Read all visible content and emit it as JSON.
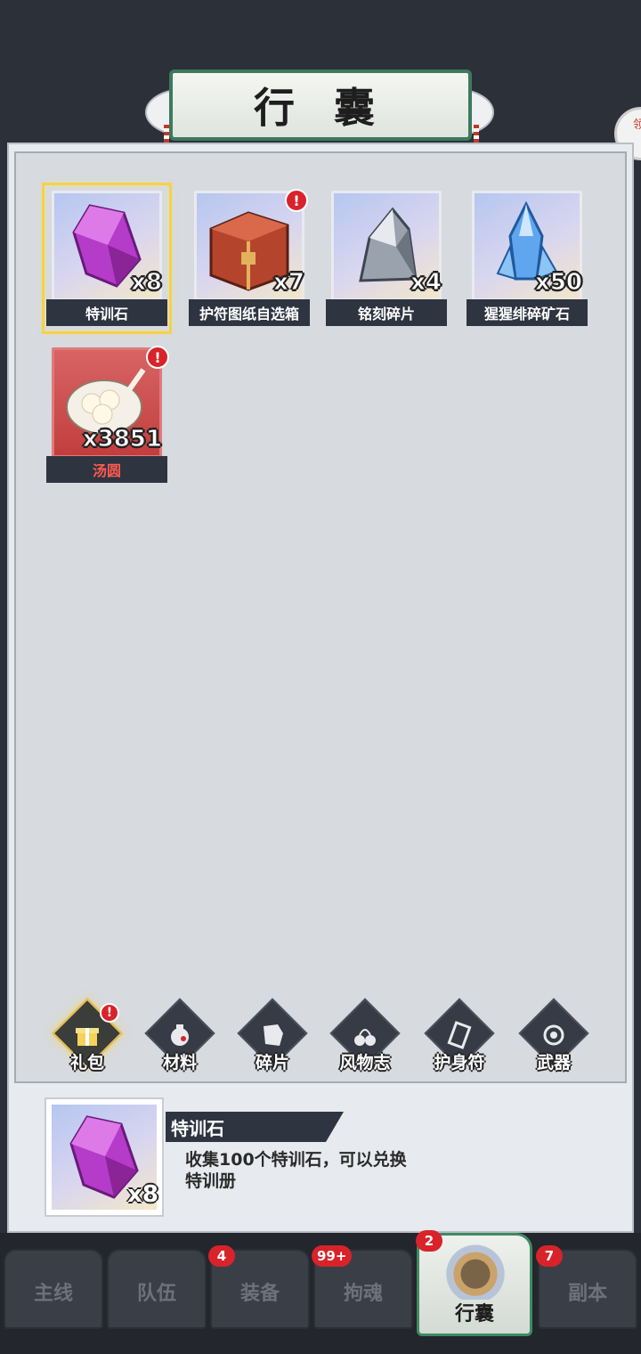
{
  "header": {
    "title": "行 囊"
  },
  "side_token": {
    "text": "领"
  },
  "items": [
    {
      "name": "特训石",
      "count": "x8",
      "selected": true,
      "alert": false,
      "icon": "purple-crystal-icon"
    },
    {
      "name": "护符图纸自选箱",
      "count": "x7",
      "selected": false,
      "alert": true,
      "icon": "treasure-chest-icon"
    },
    {
      "name": "铭刻碎片",
      "count": "x4",
      "selected": false,
      "alert": false,
      "icon": "stone-shard-icon"
    },
    {
      "name": "猩猩绯碎矿石",
      "count": "x50",
      "selected": false,
      "alert": false,
      "icon": "blue-crystal-icon"
    },
    {
      "name": "汤圆",
      "count": "x3851",
      "selected": false,
      "alert": true,
      "icon": "tangyuan-bowl-icon"
    }
  ],
  "alert_mark": "!",
  "categories": [
    {
      "label": "礼包",
      "icon": "gift-icon",
      "active": true,
      "alert": true
    },
    {
      "label": "材料",
      "icon": "material-pouch-icon",
      "active": false,
      "alert": false
    },
    {
      "label": "碎片",
      "icon": "fragment-icon",
      "active": false,
      "alert": false
    },
    {
      "label": "风物志",
      "icon": "cherries-icon",
      "active": false,
      "alert": false
    },
    {
      "label": "护身符",
      "icon": "talisman-icon",
      "active": false,
      "alert": false
    },
    {
      "label": "武器",
      "icon": "weapon-emblem-icon",
      "active": false,
      "alert": false
    }
  ],
  "detail": {
    "name": "特训石",
    "count": "x8",
    "description": "收集100个特训石，可以兑换特训册"
  },
  "bottom_nav": [
    {
      "label": "主线",
      "badge": ""
    },
    {
      "label": "队伍",
      "badge": ""
    },
    {
      "label": "装备",
      "badge": "4"
    },
    {
      "label": "拘魂",
      "badge": "99+"
    },
    {
      "label": "行囊",
      "badge": "2",
      "active": true
    },
    {
      "label": "副本",
      "badge": "7"
    }
  ],
  "colors": {
    "accent_green": "#3f8a62",
    "alert_red": "#d8232a",
    "selected_gold": "#f4d24a",
    "panel_bg": "#d7dade"
  }
}
